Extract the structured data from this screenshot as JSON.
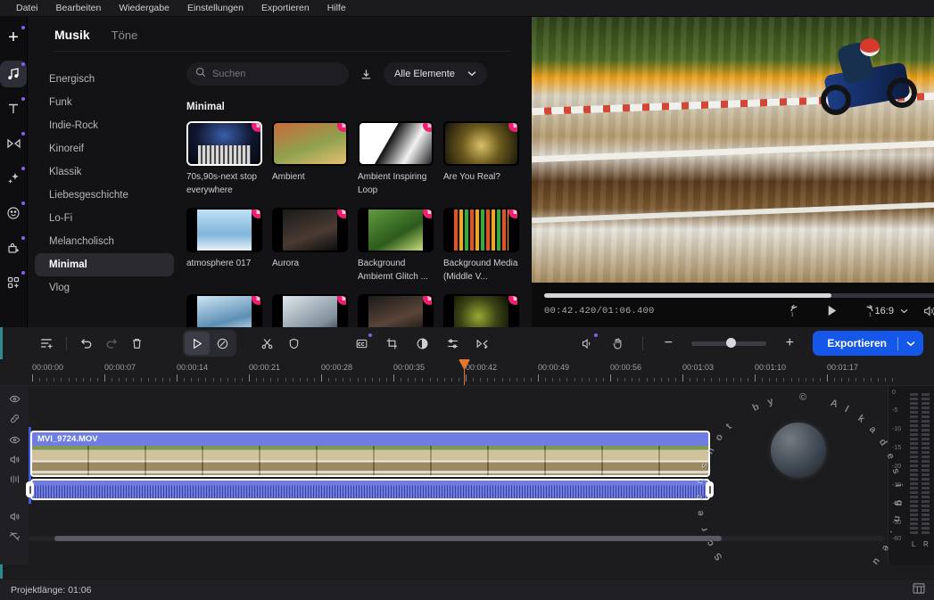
{
  "menubar": {
    "items": [
      "Datei",
      "Bearbeiten",
      "Wiedergabe",
      "Einstellungen",
      "Exportieren",
      "Hilfe"
    ]
  },
  "rail": {
    "add_label": "+",
    "items": [
      {
        "name": "music-icon",
        "label": "Musik"
      },
      {
        "name": "text-icon",
        "label": "Text"
      },
      {
        "name": "transition-icon",
        "label": "Übergänge"
      },
      {
        "name": "effects-icon",
        "label": "Effekte"
      },
      {
        "name": "sticker-icon",
        "label": "Sticker"
      },
      {
        "name": "filter-icon",
        "label": "Filter"
      },
      {
        "name": "elements-icon",
        "label": "Elemente"
      }
    ]
  },
  "library": {
    "tabs": [
      {
        "label": "Musik",
        "active": true
      },
      {
        "label": "Töne",
        "active": false
      }
    ],
    "categories": [
      "Energisch",
      "Funk",
      "Indie-Rock",
      "Kinoreif",
      "Klassik",
      "Liebesgeschichte",
      "Lo-Fi",
      "Melancholisch",
      "Minimal",
      "Vlog"
    ],
    "selected_category": "Minimal",
    "search": {
      "value": "",
      "placeholder": "Suchen"
    },
    "download_icon": "download-icon",
    "filter_dropdown": {
      "label": "Alle Elemente"
    },
    "section_title": "Minimal",
    "badge": "crown",
    "items": [
      {
        "title": "70s,90s-next stop everywhere",
        "art": "a1",
        "selected": true,
        "premium": true
      },
      {
        "title": "Ambient",
        "art": "a2",
        "selected": false,
        "premium": true
      },
      {
        "title": "Ambient Inspiring Loop",
        "art": "a3",
        "selected": false,
        "premium": true
      },
      {
        "title": "Are You Real?",
        "art": "a4",
        "selected": false,
        "premium": true
      },
      {
        "title": "atmosphere 017",
        "art": "a5",
        "selected": false,
        "premium": true
      },
      {
        "title": "Aurora",
        "art": "a6",
        "selected": false,
        "premium": true
      },
      {
        "title": "Background Ambiemt Glitch ...",
        "art": "a7",
        "selected": false,
        "premium": true
      },
      {
        "title": "Background Media (Middle V...",
        "art": "a8",
        "selected": false,
        "premium": true
      },
      {
        "title": "",
        "art": "a9",
        "selected": false,
        "premium": true
      },
      {
        "title": "",
        "art": "a10",
        "selected": false,
        "premium": true
      },
      {
        "title": "",
        "art": "a11",
        "selected": false,
        "premium": true
      },
      {
        "title": "",
        "art": "a12",
        "selected": false,
        "premium": true
      }
    ]
  },
  "preview": {
    "help_label": "?",
    "timecode": "00:42.420/01:06.400",
    "progress_percent": 64,
    "controls": [
      "undo-1s-icon",
      "play-icon",
      "redo-1s-icon"
    ],
    "aspect_ratio": "16:9",
    "right_icons": [
      "volume-icon",
      "fullscreen-icon",
      "settings-gear-icon"
    ]
  },
  "timeline": {
    "toolbar_left": [
      "add-track-icon",
      "undo-icon",
      "redo-icon",
      "delete-icon"
    ],
    "toolgroup": [
      "select-tool-icon",
      "split-tool-icon"
    ],
    "toolgroup2": [
      "cut-icon",
      "mask-icon"
    ],
    "toolgroup3": [
      "captions-icon",
      "crop-icon",
      "contrast-icon",
      "audio-mixer-icon",
      "transition-icon"
    ],
    "toolbar_right": [
      "detach-audio-icon",
      "hand-tool-icon"
    ],
    "zoom_out_label": "−",
    "zoom_in_label": "+",
    "zoom_value": 46,
    "export_button": {
      "label": "Exportieren",
      "color": "#1557e8"
    },
    "ruler": {
      "labels": [
        "00:00:00",
        "00:00:07",
        "00:00:14",
        "00:00:21",
        "00:00:28",
        "00:00:35",
        "00:00:42",
        "00:00:49",
        "00:00:56",
        "00:01:03",
        "00:01:10",
        "00:01:17"
      ]
    },
    "playhead": {
      "position_percent": 49.7,
      "color": "#e8762a"
    },
    "tracks": [
      {
        "name": "overlay-track",
        "icons": [
          "eye-icon",
          "link-icon"
        ]
      },
      {
        "name": "video-track",
        "icons": [
          "eye-icon",
          "volume-icon",
          "mixer-icon"
        ]
      },
      {
        "name": "audio-track",
        "icons": [
          "volume-icon",
          "hidden-eye-icon"
        ]
      }
    ],
    "clip": {
      "title": "MVI_9724.MOV",
      "color": "#6f7de0"
    },
    "meter": {
      "scale": [
        "0",
        "-5",
        "-10",
        "-15",
        "-20",
        "-30",
        "-40",
        "-50",
        "-60"
      ],
      "channels": [
        "L",
        "R"
      ]
    }
  },
  "statusbar": {
    "project_length": "Projektlänge: 01:06"
  },
  "watermark": {
    "text": "Screenshot by © Alkadesign.eu"
  }
}
